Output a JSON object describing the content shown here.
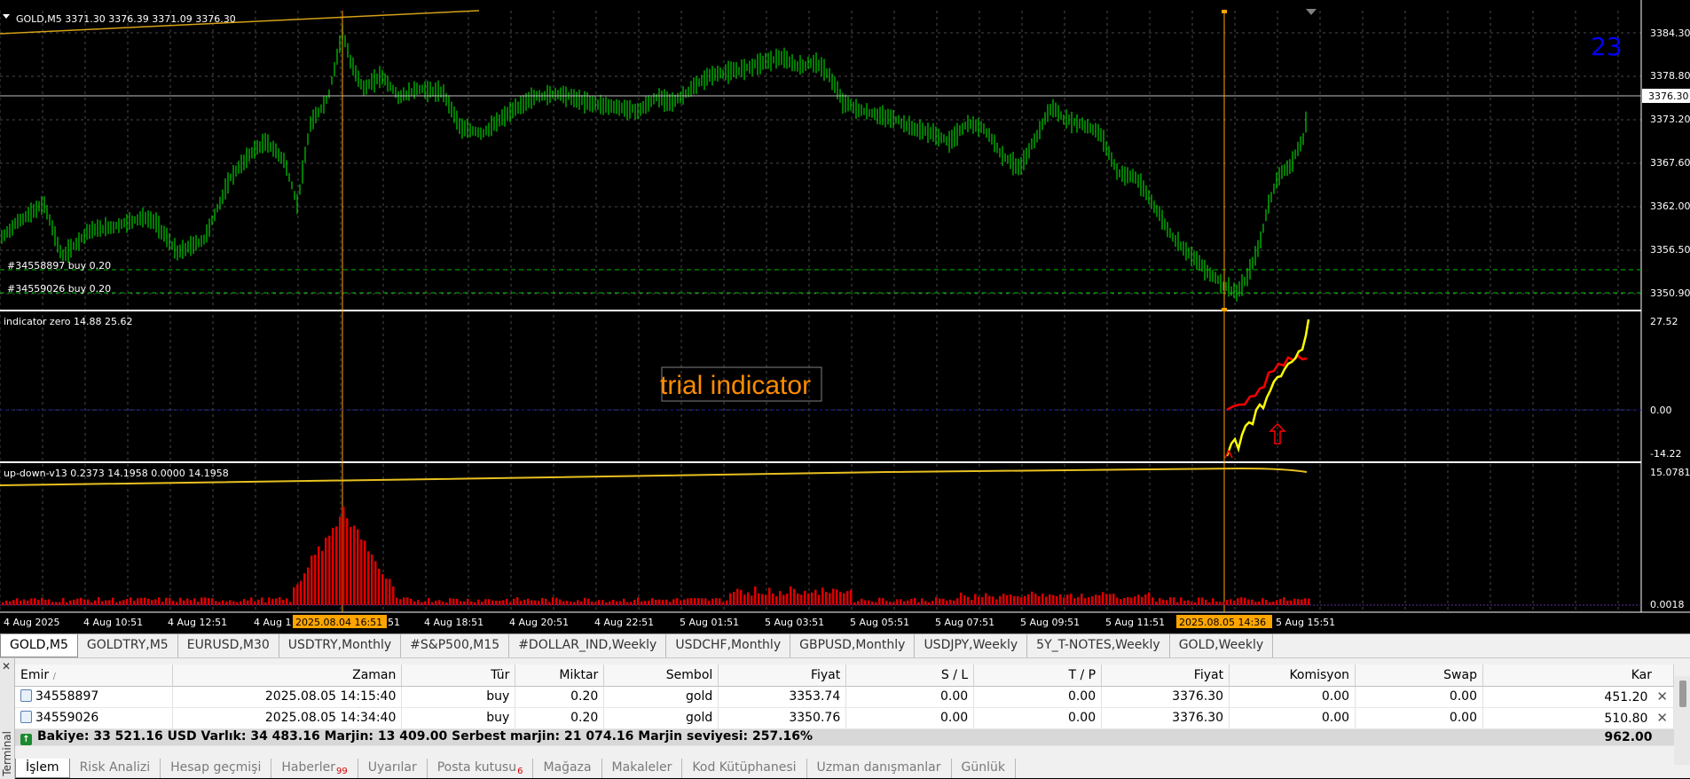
{
  "main_chart": {
    "header": "GOLD,M5  3371.30 3376.39 3371.09 3376.30",
    "bar_count_label": "23",
    "price_axis": [
      "3384.30",
      "3378.80",
      "3373.20",
      "3367.60",
      "3362.00",
      "3356.50",
      "3350.90"
    ],
    "current_price_tag": "3376.30",
    "order_lines": [
      "#34558897 buy 0.20",
      "#34559026 buy 0.20"
    ]
  },
  "indicator1": {
    "header": "indicator zero 14.88 25.62",
    "axis": [
      "27.52",
      "0.00",
      "-14.22"
    ],
    "trial_text": "trial indicator"
  },
  "indicator2": {
    "header": "up-down-v13 0.2373 14.1958 0.0000 14.1958",
    "axis_top": "15.0781",
    "axis_bottom": "0.0018"
  },
  "time_axis": {
    "labels": [
      "4 Aug 2025",
      "4 Aug 10:51",
      "4 Aug 12:51",
      "4 Aug 1",
      "51",
      "4 Aug 18:51",
      "4 Aug 20:51",
      "4 Aug 22:51",
      "5 Aug 01:51",
      "5 Aug 03:51",
      "5 Aug 05:51",
      "5 Aug 07:51",
      "5 Aug 09:51",
      "5 Aug 11:51",
      "5 Aug 15:51"
    ],
    "highlight_1": "2025.08.04 16:51",
    "highlight_2": "2025.08.05 14:36"
  },
  "chart_tabs": [
    "GOLD,M5",
    "GOLDTRY,M5",
    "EURUSD,M30",
    "USDTRY,Monthly",
    "#S&P500,M15",
    "#DOLLAR_IND,Weekly",
    "USDCHF,Monthly",
    "GBPUSD,Monthly",
    "USDJPY,Weekly",
    "5Y_T-NOTES,Weekly",
    "GOLD,Weekly"
  ],
  "terminal": {
    "side_label": "Terminal",
    "close_glyph": "✕",
    "columns": [
      "Emir",
      "Zaman",
      "Tür",
      "Miktar",
      "Sembol",
      "Fiyat",
      "S / L",
      "T / P",
      "Fiyat",
      "Komisyon",
      "Swap",
      "Kar"
    ],
    "sort_glyph": "/",
    "rows": [
      [
        "34558897",
        "2025.08.05 14:15:40",
        "buy",
        "0.20",
        "gold",
        "3353.74",
        "0.00",
        "0.00",
        "3376.30",
        "0.00",
        "0.00",
        "451.20"
      ],
      [
        "34559026",
        "2025.08.05 14:34:40",
        "buy",
        "0.20",
        "gold",
        "3350.76",
        "0.00",
        "0.00",
        "3376.30",
        "0.00",
        "0.00",
        "510.80"
      ]
    ],
    "summary": "Bakiye: 33 521.16 USD  Varlık: 34 483.16  Marjin: 13 409.00  Serbest marjin: 21 074.16  Marjin seviyesi: 257.16%",
    "summary_profit": "962.00",
    "tabs": [
      {
        "label": "İşlem",
        "badge": ""
      },
      {
        "label": "Risk Analizi",
        "badge": ""
      },
      {
        "label": "Hesap geçmişi",
        "badge": ""
      },
      {
        "label": "Haberler",
        "badge": "99"
      },
      {
        "label": "Uyarılar",
        "badge": ""
      },
      {
        "label": "Posta kutusu",
        "badge": "6"
      },
      {
        "label": "Mağaza",
        "badge": ""
      },
      {
        "label": "Makaleler",
        "badge": ""
      },
      {
        "label": "Kod Kütüphanesi",
        "badge": ""
      },
      {
        "label": "Uzman danışmanlar",
        "badge": ""
      },
      {
        "label": "Günlük",
        "badge": ""
      }
    ]
  },
  "colors": {
    "candle": "#00c000",
    "grid": "#4a4a4a",
    "vline": "#ffa500",
    "yellow_line": "#ffff00",
    "red_line": "#ff0000",
    "histogram": "#dd0000",
    "trial_text": "#ff8c00",
    "bar_count": "#0000ff"
  }
}
